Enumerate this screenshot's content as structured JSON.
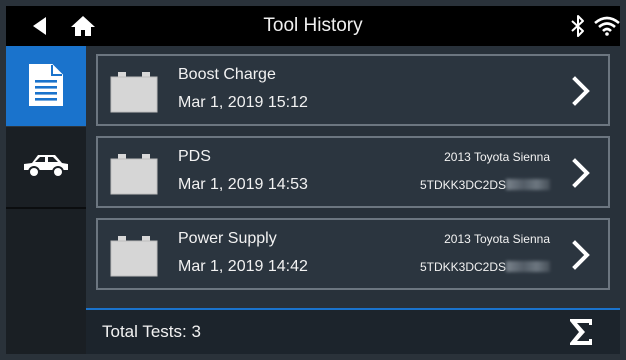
{
  "header": {
    "title": "Tool History",
    "back_icon": "back-arrow-icon",
    "home_icon": "home-icon",
    "status_icons": [
      "bluetooth-icon",
      "wifi-icon"
    ]
  },
  "sidebar": {
    "items": [
      {
        "icon": "document-icon",
        "active": true
      },
      {
        "icon": "car-icon",
        "active": false
      }
    ]
  },
  "records": [
    {
      "name": "Boost Charge",
      "date": "Mar 1, 2019 15:12",
      "vehicle": "",
      "vin": ""
    },
    {
      "name": "PDS",
      "date": "Mar 1, 2019 14:53",
      "vehicle": "2013 Toyota Sienna",
      "vin": "5TDKK3DC2DS"
    },
    {
      "name": "Power Supply",
      "date": "Mar 1, 2019 14:42",
      "vehicle": "2013 Toyota Sienna",
      "vin": "5TDKK3DC2DS"
    }
  ],
  "footer": {
    "total_label": "Total Tests: 3",
    "summary_icon": "sigma-icon"
  },
  "colors": {
    "accent": "#1a73cc",
    "card_border": "#6c7680",
    "background": "#28313a",
    "header": "#000000"
  }
}
